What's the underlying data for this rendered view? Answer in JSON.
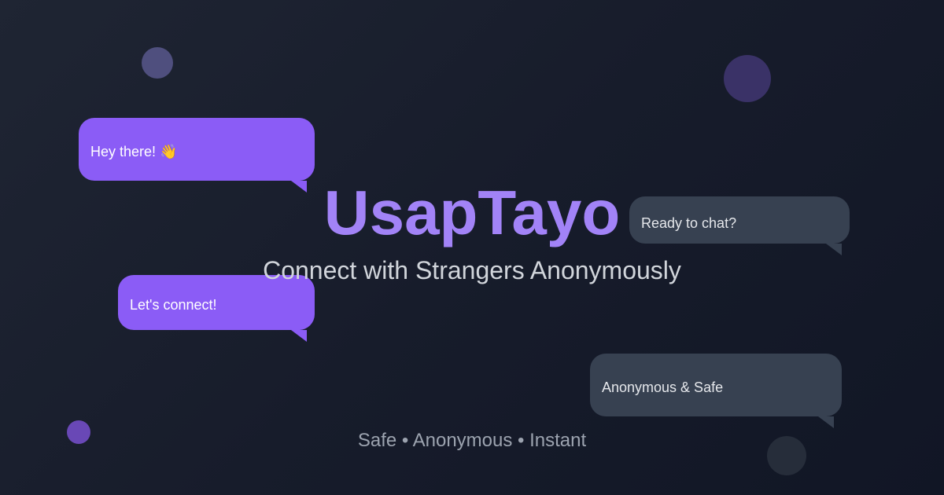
{
  "brand": {
    "name": "UsapTayo",
    "tagline": "Connect with Strangers Anonymously",
    "features": "Safe • Anonymous • Instant",
    "accent_color": "#a283f7"
  },
  "bubbles": [
    {
      "text": "Hey there! 👋",
      "style": "purple"
    },
    {
      "text": "Ready to chat?",
      "style": "gray"
    },
    {
      "text": "Let's connect!",
      "style": "purple"
    },
    {
      "text": "Anonymous & Safe",
      "style": "gray"
    }
  ],
  "colors": {
    "bubble_purple": "#8b5cf6",
    "bubble_gray": "#374151",
    "background_start": "#1f2533",
    "background_end": "#111625"
  }
}
